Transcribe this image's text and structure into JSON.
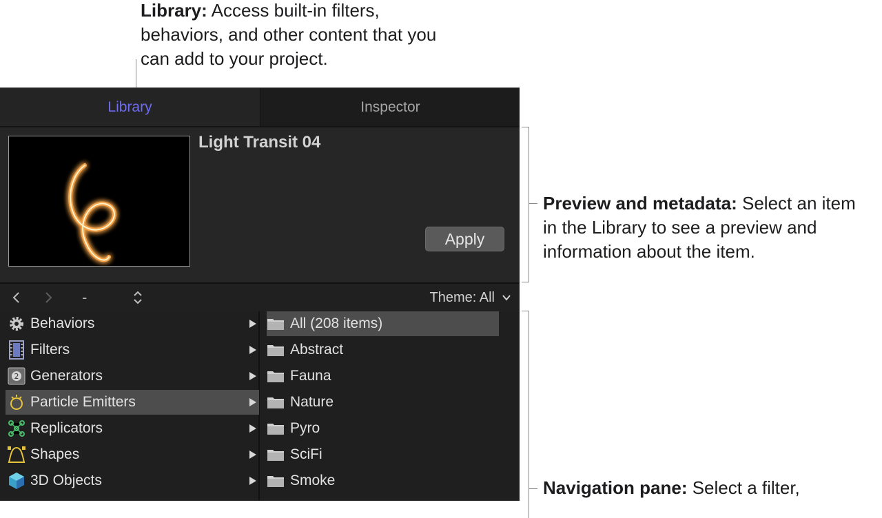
{
  "callouts": {
    "library": {
      "title": "Library:",
      "text": " Access built-in filters, behaviors, and other content that you can add to your project."
    },
    "preview": {
      "title": "Preview and metadata:",
      "text": " Select an item in the Library to see a preview and information about the item."
    },
    "navigation": {
      "title": "Navigation pane:",
      "text": " Select a filter,"
    }
  },
  "tabs": {
    "library": "Library",
    "inspector": "Inspector",
    "active": "Library"
  },
  "preview": {
    "item_title": "Light Transit 04",
    "apply_label": "Apply"
  },
  "toolbar": {
    "back_icon": "chevron-left",
    "forward_icon": "chevron-right",
    "dash": "-",
    "sort_icon": "up-down-chevron",
    "theme_label": "Theme: All"
  },
  "categories": [
    {
      "label": "Behaviors",
      "icon": "gear-icon"
    },
    {
      "label": "Filters",
      "icon": "film-icon"
    },
    {
      "label": "Generators",
      "icon": "generator-icon"
    },
    {
      "label": "Particle Emitters",
      "icon": "particle-emitter-icon",
      "selected": true
    },
    {
      "label": "Replicators",
      "icon": "replicator-icon"
    },
    {
      "label": "Shapes",
      "icon": "shape-icon"
    },
    {
      "label": "3D Objects",
      "icon": "cube-icon"
    }
  ],
  "folders": [
    {
      "label": "All (208 items)",
      "selected": true
    },
    {
      "label": "Abstract"
    },
    {
      "label": "Fauna"
    },
    {
      "label": "Nature"
    },
    {
      "label": "Pyro"
    },
    {
      "label": "SciFi"
    },
    {
      "label": "Smoke"
    }
  ],
  "colors": {
    "accent": "#6f6cf0",
    "panel_bg": "#262626",
    "selected_row": "#4d4d4d"
  }
}
